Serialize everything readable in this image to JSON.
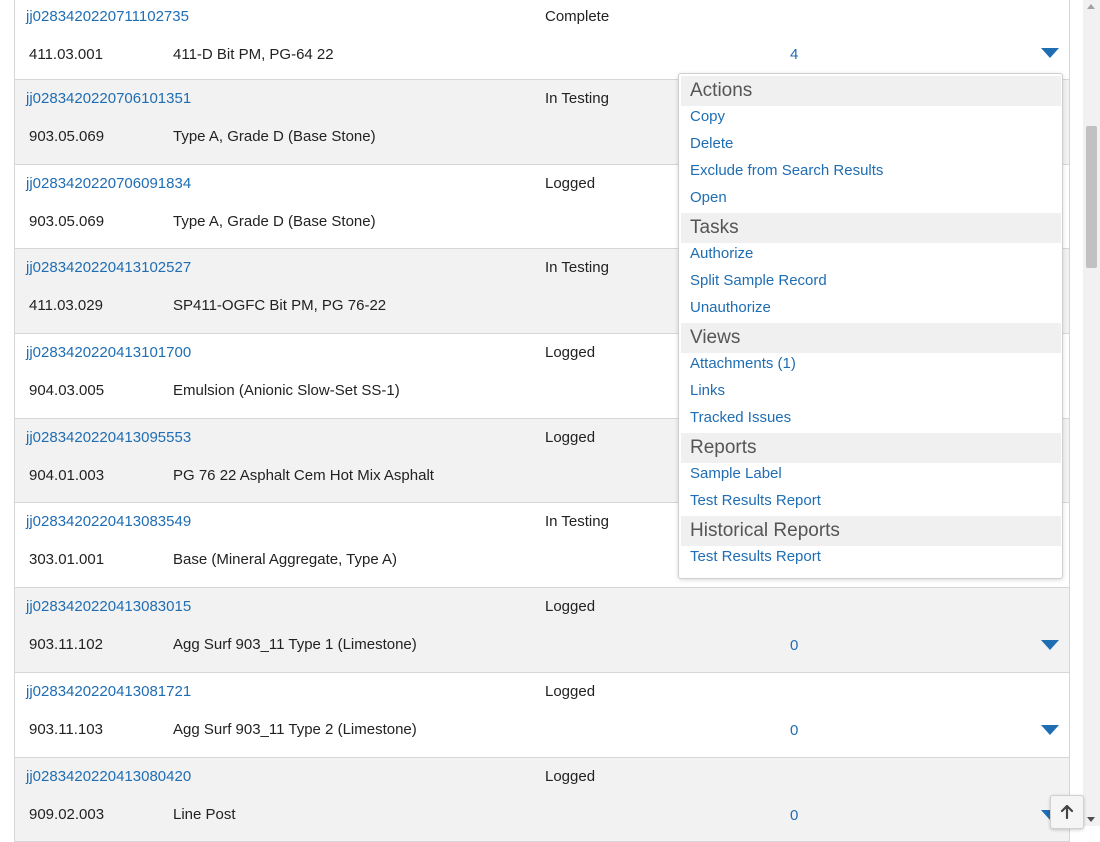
{
  "rows": [
    {
      "sample_id": "jj0283420220711102735",
      "status": "Complete",
      "code": "411.03.001",
      "description": "411-D Bit PM, PG-64 22",
      "count": "4"
    },
    {
      "sample_id": "jj0283420220706101351",
      "status": "In Testing",
      "code": "903.05.069",
      "description": "Type A, Grade D (Base Stone)",
      "count": ""
    },
    {
      "sample_id": "jj0283420220706091834",
      "status": "Logged",
      "code": "903.05.069",
      "description": "Type A, Grade D (Base Stone)",
      "count": ""
    },
    {
      "sample_id": "jj0283420220413102527",
      "status": "In Testing",
      "code": "411.03.029",
      "description": "SP411-OGFC Bit PM, PG 76-22",
      "count": ""
    },
    {
      "sample_id": "jj0283420220413101700",
      "status": "Logged",
      "code": "904.03.005",
      "description": "Emulsion (Anionic Slow-Set SS-1)",
      "count": ""
    },
    {
      "sample_id": "jj0283420220413095553",
      "status": "Logged",
      "code": "904.01.003",
      "description": "PG 76 22 Asphalt Cem Hot Mix Asphalt",
      "count": ""
    },
    {
      "sample_id": "jj0283420220413083549",
      "status": "In Testing",
      "code": "303.01.001",
      "description": "Base (Mineral Aggregate, Type A)",
      "count": ""
    },
    {
      "sample_id": "jj0283420220413083015",
      "status": "Logged",
      "code": "903.11.102",
      "description": "Agg Surf 903_11 Type 1 (Limestone)",
      "count": "0"
    },
    {
      "sample_id": "jj0283420220413081721",
      "status": "Logged",
      "code": "903.11.103",
      "description": "Agg Surf 903_11 Type 2 (Limestone)",
      "count": "0"
    },
    {
      "sample_id": "jj0283420220413080420",
      "status": "Logged",
      "code": "909.02.003",
      "description": "Line Post",
      "count": "0"
    }
  ],
  "menu": {
    "sections": [
      {
        "title": "Actions",
        "items": [
          "Copy",
          "Delete",
          "Exclude from Search Results",
          "Open"
        ]
      },
      {
        "title": "Tasks",
        "items": [
          "Authorize",
          "Split Sample Record",
          "Unauthorize"
        ]
      },
      {
        "title": "Views",
        "items": [
          "Attachments (1)",
          "Links",
          "Tracked Issues"
        ]
      },
      {
        "title": "Reports",
        "items": [
          "Sample Label",
          "Test Results Report"
        ]
      },
      {
        "title": "Historical Reports",
        "items": [
          "Test Results Report"
        ]
      }
    ]
  },
  "icons": {
    "expand": "caret-down-icon",
    "close": "close-x-icon",
    "back_to_top": "arrow-up-icon"
  },
  "colors": {
    "link": "#1f6db3",
    "alt_row": "#f2f2f2",
    "section_header": "#f0f0f0",
    "caret": "#1f6db3"
  }
}
